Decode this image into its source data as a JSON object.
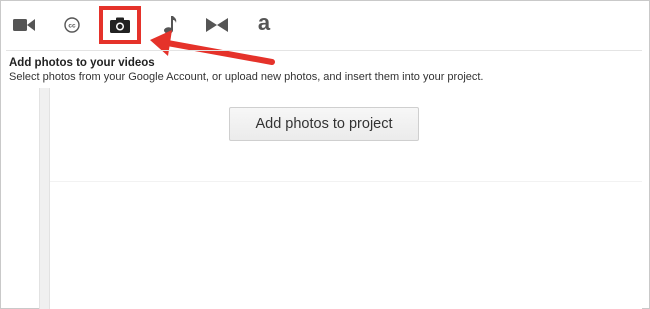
{
  "toolbar": {
    "tools": [
      {
        "name": "video",
        "icon": "video-camera-icon"
      },
      {
        "name": "captions",
        "icon": "cc-icon"
      },
      {
        "name": "photos",
        "icon": "camera-icon",
        "active": true
      },
      {
        "name": "audio",
        "icon": "music-note-icon"
      },
      {
        "name": "transitions",
        "icon": "bowtie-transition-icon"
      },
      {
        "name": "text",
        "icon": "text-icon",
        "glyph": "a"
      }
    ]
  },
  "section": {
    "title": "Add photos to your videos",
    "description": "Select photos from your Google Account, or upload new photos, and insert them into your project."
  },
  "add_button_label": "Add photos to project",
  "colors": {
    "highlight": "#e5322a",
    "icon": "#555555"
  }
}
